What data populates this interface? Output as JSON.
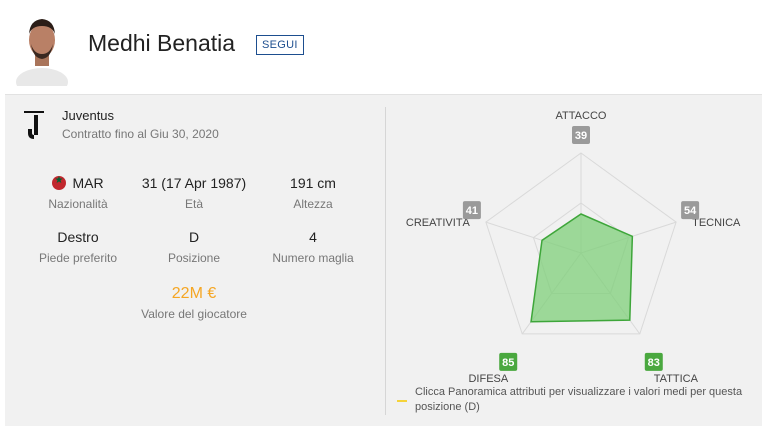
{
  "player": {
    "name": "Medhi Benatia",
    "follow_label": "SEGUI"
  },
  "club": {
    "name": "Juventus",
    "contract": "Contratto fino al Giu 30, 2020"
  },
  "stats": {
    "nationality": {
      "value": "MAR",
      "label": "Nazionalità"
    },
    "age": {
      "value": "31 (17 Apr 1987)",
      "label": "Età"
    },
    "height": {
      "value": "191 cm",
      "label": "Altezza"
    },
    "foot": {
      "value": "Destro",
      "label": "Piede preferito"
    },
    "position": {
      "value": "D",
      "label": "Posizione"
    },
    "shirt": {
      "value": "4",
      "label": "Numero maglia"
    },
    "market_value": {
      "value": "22M €",
      "label": "Valore del giocatore"
    }
  },
  "colors": {
    "accent": "#f5a623",
    "radar_fill": "#7fcf7a",
    "radar_stroke": "#3ea63a",
    "badge_grey": "#9a9a9a",
    "badge_green": "#4aa83f"
  },
  "legend": "Clicca Panoramica attributi per visualizzare i valori medi per questa posizione (D)",
  "chart_data": {
    "type": "radar",
    "max": 100,
    "categories": [
      "ATTACCO",
      "TECNICA",
      "TATTICA",
      "DIFESA",
      "CREATIVITÀ"
    ],
    "values": [
      39,
      54,
      83,
      85,
      41
    ],
    "badge_color": [
      "grey",
      "grey",
      "green",
      "green",
      "grey"
    ]
  }
}
